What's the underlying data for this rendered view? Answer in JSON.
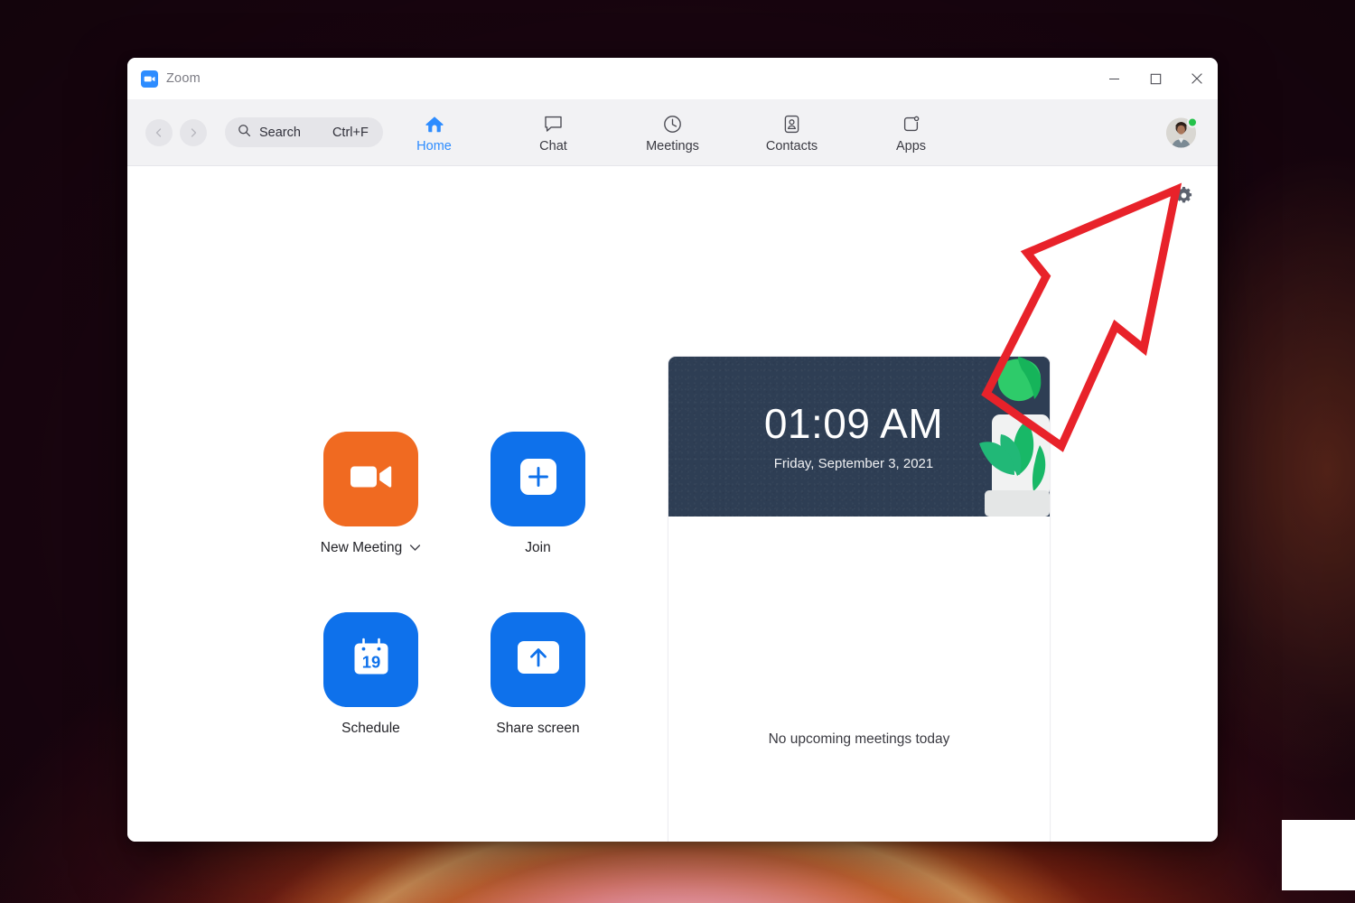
{
  "desktop": {
    "wallpaper_name": "windows-11-bloom-wallpaper",
    "colors": {
      "deep": "#1b0610",
      "ember": "#d4541c",
      "bloom": "#c68cff"
    }
  },
  "window": {
    "title": "Zoom",
    "logo_icon": "zoom-camera-icon",
    "controls": [
      {
        "name": "minimize-button",
        "icon": "minimize-icon",
        "label": "─"
      },
      {
        "name": "maximize-button",
        "icon": "maximize-icon",
        "label": "□"
      },
      {
        "name": "close-button",
        "icon": "close-icon",
        "label": "✕"
      }
    ]
  },
  "toolbar": {
    "back_icon": "chevron-left-icon",
    "forward_icon": "chevron-right-icon",
    "search": {
      "icon": "search-icon",
      "placeholder": "Search",
      "shortcut": "Ctrl+F"
    },
    "tabs": [
      {
        "label": "Home",
        "icon": "home-icon",
        "active": true
      },
      {
        "label": "Chat",
        "icon": "chat-bubble-icon",
        "active": false
      },
      {
        "label": "Meetings",
        "icon": "clock-icon",
        "active": false
      },
      {
        "label": "Contacts",
        "icon": "contact-card-icon",
        "active": false
      },
      {
        "label": "Apps",
        "icon": "apps-grid-icon",
        "active": false
      }
    ],
    "active_tab_color": "#2d8cff",
    "avatar": {
      "name": "user-avatar",
      "presence": "available",
      "presence_color": "#24c24a"
    }
  },
  "main": {
    "settings_icon": "gear-icon",
    "actions": [
      {
        "label": "New Meeting",
        "icon": "video-camera-icon",
        "tile_color": "#f06a21",
        "has_dropdown": true,
        "dropdown_icon": "chevron-down-icon"
      },
      {
        "label": "Join",
        "icon": "plus-icon",
        "tile_color": "#0e71eb",
        "has_dropdown": false
      },
      {
        "label": "Schedule",
        "icon": "calendar-19-icon",
        "tile_color": "#0e71eb",
        "has_dropdown": false,
        "calendar_day": "19"
      },
      {
        "label": "Share screen",
        "icon": "arrow-up-screen-icon",
        "tile_color": "#0e71eb",
        "has_dropdown": false
      }
    ],
    "meetings_panel": {
      "clock": {
        "time": "01:09 AM",
        "date": "Friday, September 3, 2021",
        "background_color": "#2e3e54",
        "illustration": "potted-plant-illustration"
      },
      "empty_state": "No upcoming meetings today"
    }
  },
  "annotation": {
    "arrow_name": "red-highlight-arrow",
    "color": "#e8222a",
    "points_to": "gear-icon"
  }
}
